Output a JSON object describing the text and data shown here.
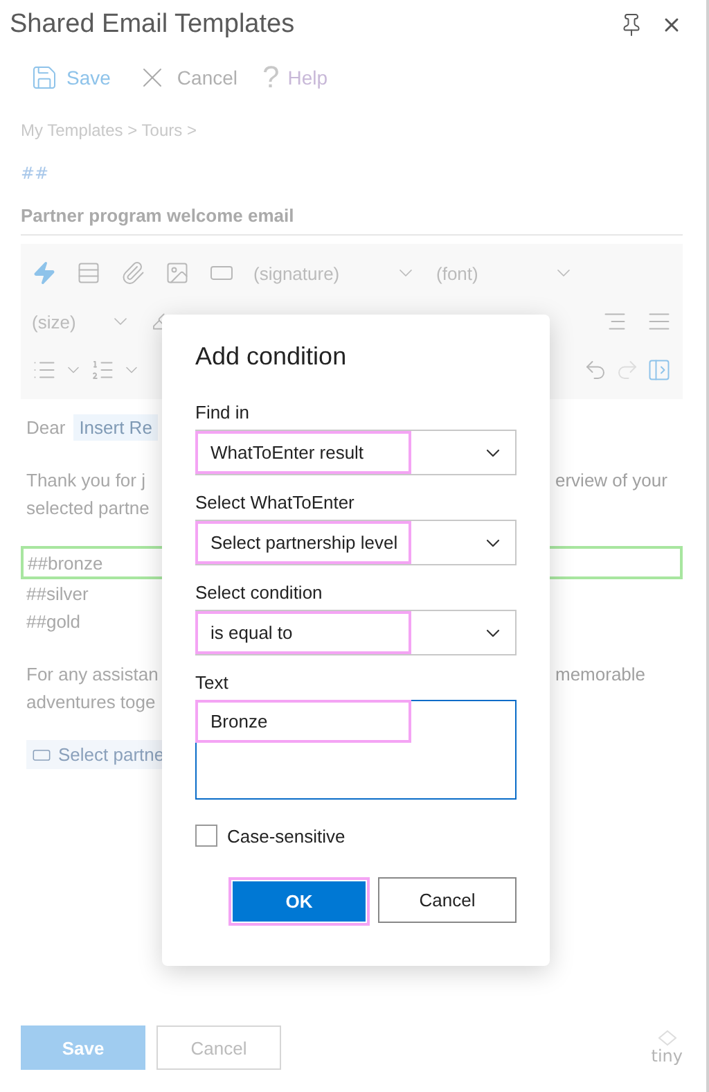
{
  "window": {
    "title": "Shared Email Templates"
  },
  "toolbar": [
    {
      "kind": "save",
      "label": "Save"
    },
    {
      "kind": "cancel",
      "label": "Cancel"
    },
    {
      "kind": "help",
      "label": "Help",
      "glyph": "?"
    }
  ],
  "breadcrumb": "My Templates > Tours >",
  "hashtag": "##",
  "subject": "Partner program welcome email",
  "editor_toolbar": {
    "signature": "(signature)",
    "font": "(font)",
    "size": "(size)"
  },
  "body": {
    "greeting": "Dear",
    "chip": "Insert Re",
    "lines": [
      {
        "kind": "text",
        "left": "Thank you for j",
        "right": "erview of your"
      },
      {
        "kind": "text",
        "left": "selected partne"
      },
      {
        "kind": "gap"
      },
      {
        "kind": "text",
        "left": "##bronze",
        "highlighted": true
      },
      {
        "kind": "text",
        "left": "##silver"
      },
      {
        "kind": "text",
        "left": "##gold"
      },
      {
        "kind": "gap"
      },
      {
        "kind": "text",
        "left": "For any assistan",
        "right": "memorable"
      },
      {
        "kind": "text",
        "left": "adventures toge"
      }
    ],
    "select_chip": "Select partne"
  },
  "footer": {
    "save": "Save",
    "cancel": "Cancel",
    "brand": "tiny"
  },
  "dialog": {
    "title": "Add condition",
    "fields": [
      {
        "kind": "select",
        "label": "Find in",
        "value": "WhatToEnter result",
        "highlighted": true
      },
      {
        "kind": "select",
        "label": "Select WhatToEnter",
        "value": "Select partnership level",
        "highlighted": true
      },
      {
        "kind": "select",
        "label": "Select condition",
        "value": "is equal to",
        "highlighted": true
      },
      {
        "kind": "textarea",
        "label": "Text",
        "value": "Bronze",
        "highlighted": true
      }
    ],
    "case_sensitive": {
      "label": "Case-sensitive",
      "checked": false
    },
    "ok": {
      "label": "OK",
      "highlighted": true
    },
    "cancel": {
      "label": "Cancel"
    }
  }
}
